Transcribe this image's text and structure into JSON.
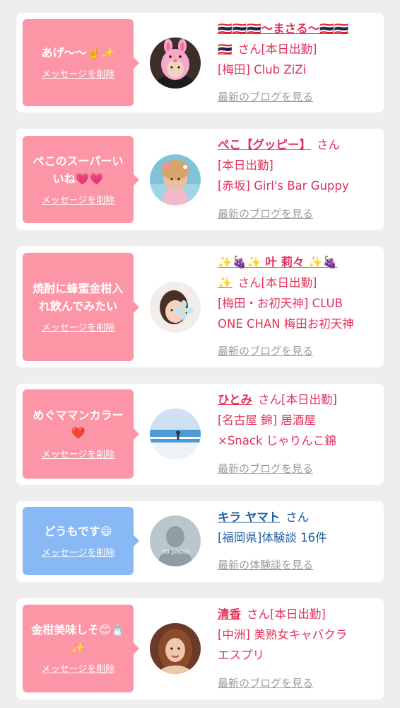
{
  "colors": {
    "background": "#eeeeee",
    "card": "#ffffff",
    "pink_bubble": "#fc95a5",
    "blue_bubble": "#88b9f4",
    "name_pink": "#e4315b",
    "name_blue": "#1f5d9f",
    "link_gray": "#9a9a9a"
  },
  "messages": [
    {
      "bubble_text": "あげ〜〜☝️✨",
      "delete_label": "メッセージを削除",
      "avatar_icon": "pink-rabbit-hood-avatar-icon",
      "name": "🇹🇭🇹🇭🇹🇭〜まさる〜🇹🇭🇹🇭",
      "name_cont": "🇹🇭",
      "honorific": "さん",
      "status": "[本日出勤]",
      "shop": "[梅田] Club ZiZi",
      "shop2": "",
      "link_label": "最新のブログを見る"
    },
    {
      "bubble_text": "ぺこのスーパーいいね💗💗",
      "delete_label": "メッセージを削除",
      "avatar_icon": "girl-portrait-avatar-icon",
      "name": "ぺこ【グッピー】",
      "honorific": "さん",
      "status": "[本日出勤]",
      "shop": "[赤坂] Girl's Bar Guppy",
      "link_label": "最新のブログを見る"
    },
    {
      "bubble_text": "焼酎に蜂蜜金柑入れ飲んでみたい",
      "delete_label": "メッセージを削除",
      "avatar_icon": "flower-portrait-avatar-icon",
      "name": "✨🍇✨ 叶 莉々 ✨🍇",
      "name_cont": "✨",
      "honorific": "さん",
      "status": "[本日出勤]",
      "shop": "[梅田・お初天神] CLUB",
      "shop2": "ONE CHAN 梅田お初天神",
      "link_label": "最新のブログを見る"
    },
    {
      "bubble_text": "めぐママンカラー❤️",
      "delete_label": "メッセージを削除",
      "avatar_icon": "seaside-photo-avatar-icon",
      "name": "ひとみ",
      "honorific": "さん",
      "status": "[本日出勤]",
      "shop": "[名古屋 錦] 居酒屋",
      "shop2": "×Snack じゃりんこ錦",
      "link_label": "最新のブログを見る"
    },
    {
      "bubble_text": "どうもです😄",
      "delete_label": "メッセージを削除",
      "avatar_icon": "no-photo-placeholder-icon",
      "avatar_caption": "no photo",
      "name": "キラ ヤマト",
      "honorific": "さん",
      "shop": "[福岡県]体験談 16件",
      "link_label": "最新の体験談を見る"
    },
    {
      "bubble_text": "金柑美味しそ😊🧂✨",
      "delete_label": "メッセージを削除",
      "avatar_icon": "woman-portrait-avatar-icon",
      "name": "清香",
      "honorific": "さん",
      "status": "[本日出勤]",
      "shop": "[中洲] 美熟女キャバクラ",
      "shop2": "エスプリ",
      "link_label": "最新のブログを見る"
    }
  ]
}
